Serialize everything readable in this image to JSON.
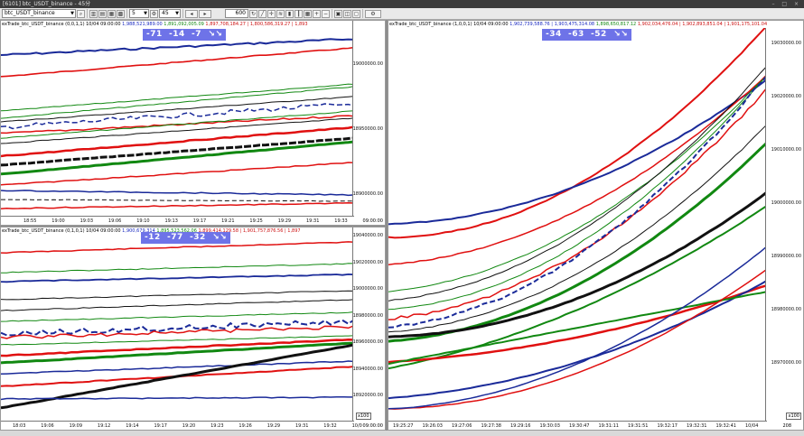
{
  "app": {
    "title": "[6101] btc_USDT_binance - 45分",
    "window_buttons": "– □ ×"
  },
  "toolbar": {
    "symbol": "btc_USDT_binance",
    "interval_count": "5",
    "interval_value": "45",
    "bar_count": "600"
  },
  "panes": {
    "top_left": {
      "header": "exTrade_btc_USDT_binance (0,0,1,1) 10/04 09:00:00",
      "values_blue": "1,988,521,989.00",
      "values_green": "1,891,092,005.09",
      "values_red": "1,897,708,184.27 | 1,800,586,319.27 | 1,893",
      "signal": "-71  -14  -7  ↘↘",
      "y_labels": [
        "19000000.00",
        "18950000.00",
        "18900000.00"
      ],
      "x_labels": [
        "18:55",
        "19:00",
        "19:03",
        "19:06",
        "19:10",
        "19:13",
        "19:17",
        "19:21",
        "19:25",
        "19:29",
        "19:31",
        "19:33",
        "10/04"
      ],
      "axis_corner": "09:00:00"
    },
    "bottom_left": {
      "header": "exTrade_btc_USDT_binance (0,1,0,1) 10/04 09:00:00",
      "values_blue": "1,900,679,314",
      "values_green": "1,895,523,562.06",
      "values_red": "1,899,414,129.58 | 1,901,757,876.56 | 1,897",
      "signal": "-12  -77  -32  ↘↘",
      "y_labels": [
        "19040000.00",
        "19020000.00",
        "19000000.00",
        "18980000.00",
        "18960000.00",
        "18940000.00",
        "18920000.00"
      ],
      "x_labels": [
        "18:03",
        "19:06",
        "19:09",
        "19:12",
        "19:14",
        "19:17",
        "19:20",
        "19:23",
        "19:26",
        "19:29",
        "19:31",
        "19:32",
        "10/04"
      ],
      "axis_corner": "09:00:00",
      "zoom": "x100"
    },
    "right": {
      "header": "exTrade_btc_USDT_binance (1,0,0,1) 10/04 09:00:00",
      "values_blue": "1,902,739,588.76 | 1,903,475,314.08",
      "values_green": "1,898,650,817.12",
      "values_red": "1,902,034,476.04 | 1,902,893,851.04 | 1,901,175,101.04",
      "signal": "-34  -63  -52  ↘↘",
      "y_labels": [
        "19030000.00",
        "19020000.00",
        "19010000.00",
        "19000000.00",
        "18990000.00",
        "18980000.00",
        "18970000.00"
      ],
      "x_labels": [
        "19:25:27",
        "19:26:03",
        "19:27:06",
        "19:27:38",
        "19:29:16",
        "19:30:03",
        "19:30:47",
        "19:31:11",
        "19:31:51",
        "19:32:17",
        "19:32:31",
        "19:32:41",
        "10/04"
      ],
      "zoom": "x100",
      "count": "208"
    }
  }
}
